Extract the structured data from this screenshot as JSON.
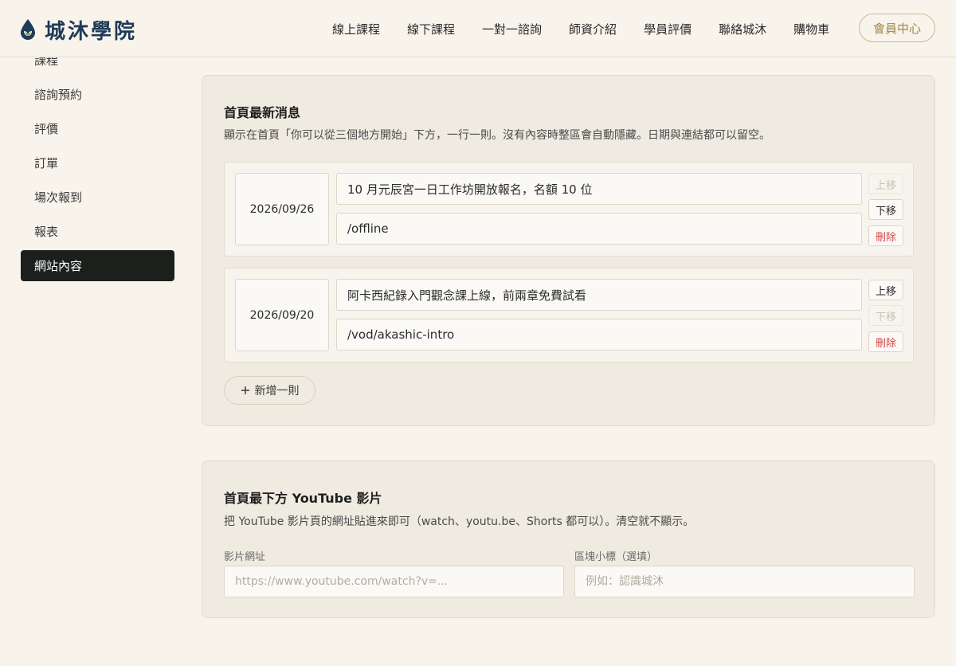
{
  "brand": {
    "name": "城沐學院"
  },
  "nav": [
    "線上課程",
    "線下課程",
    "一對一諮詢",
    "師資介紹",
    "學員評價",
    "聯絡城沐",
    "購物車"
  ],
  "member_button": "會員中心",
  "sidebar": {
    "items": [
      {
        "label": "課程"
      },
      {
        "label": "諮詢預約"
      },
      {
        "label": "評價"
      },
      {
        "label": "訂單"
      },
      {
        "label": "場次報到"
      },
      {
        "label": "報表"
      },
      {
        "label": "網站內容",
        "active": true
      }
    ]
  },
  "news": {
    "title": "首頁最新消息",
    "description": "顯示在首頁「你可以從三個地方開始」下方，一行一則。沒有內容時整區會自動隱藏。日期與連結都可以留空。",
    "items": [
      {
        "date": "2026/09/26",
        "text": "10 月元辰宮一日工作坊開放報名，名額 10 位",
        "link": "/offline"
      },
      {
        "date": "2026/09/20",
        "text": "阿卡西紀錄入門觀念課上線，前兩章免費試看",
        "link": "/vod/akashic-intro"
      }
    ],
    "move_up": "上移",
    "move_down": "下移",
    "delete": "刪除",
    "add_label": "新增一則"
  },
  "youtube": {
    "title": "首頁最下方 YouTube 影片",
    "description": "把 YouTube 影片頁的網址貼進來即可（watch、youtu.be、Shorts 都可以）。清空就不顯示。",
    "url_label": "影片網址",
    "url_placeholder": "https://www.youtube.com/watch?v=...",
    "subtitle_label": "區塊小標（選填）",
    "subtitle_placeholder": "例如：認識城沐"
  },
  "colors": {
    "background": "#f8f4ec",
    "brand": "#1f3b57",
    "accent_gold": "#a0864a",
    "sidebar_active": "#1b201c",
    "danger": "#d04a4a"
  }
}
